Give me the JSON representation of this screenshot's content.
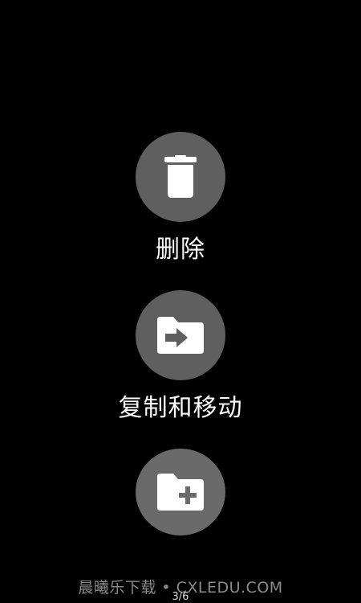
{
  "actions": [
    {
      "label": "删除",
      "icon": "trash-icon"
    },
    {
      "label": "复制和移动",
      "icon": "folder-move-icon"
    },
    {
      "label": "",
      "icon": "folder-add-icon"
    }
  ],
  "watermark": "晨曦乐下载 • CXLEDU.COM",
  "page_indicator": "3/6",
  "colors": {
    "background": "#000000",
    "circle": "#5f5f5f",
    "icon": "#ffffff",
    "watermark": "#8a8a8a"
  }
}
